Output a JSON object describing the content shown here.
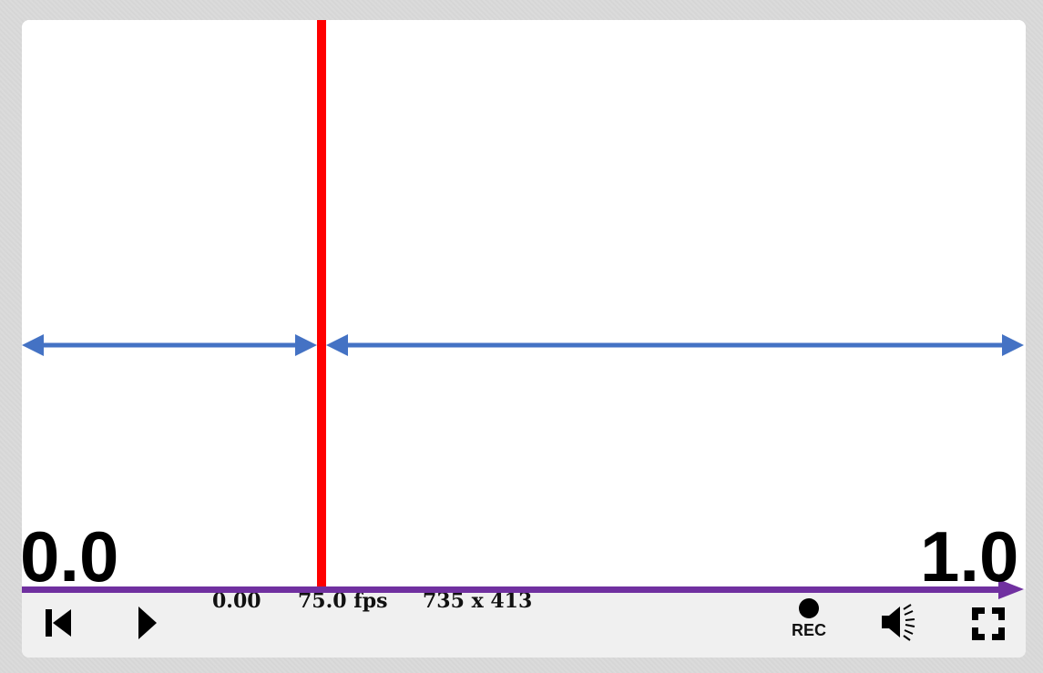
{
  "player": {
    "time": "0.00",
    "fps": "75.0 fps",
    "resolution": "735 x 413",
    "rec_label": "REC"
  },
  "annotations": {
    "start_label": "0.0",
    "end_label": "1.0",
    "playhead_fraction": 0.3
  },
  "colors": {
    "playhead": "#ff0000",
    "span_arrows": "#4472c4",
    "timeline_arrow": "#7030a0",
    "controls_bg": "#f0f0f0"
  },
  "icons": [
    "rewind-to-start-icon",
    "play-icon",
    "record-icon",
    "volume-icon",
    "fullscreen-icon"
  ]
}
